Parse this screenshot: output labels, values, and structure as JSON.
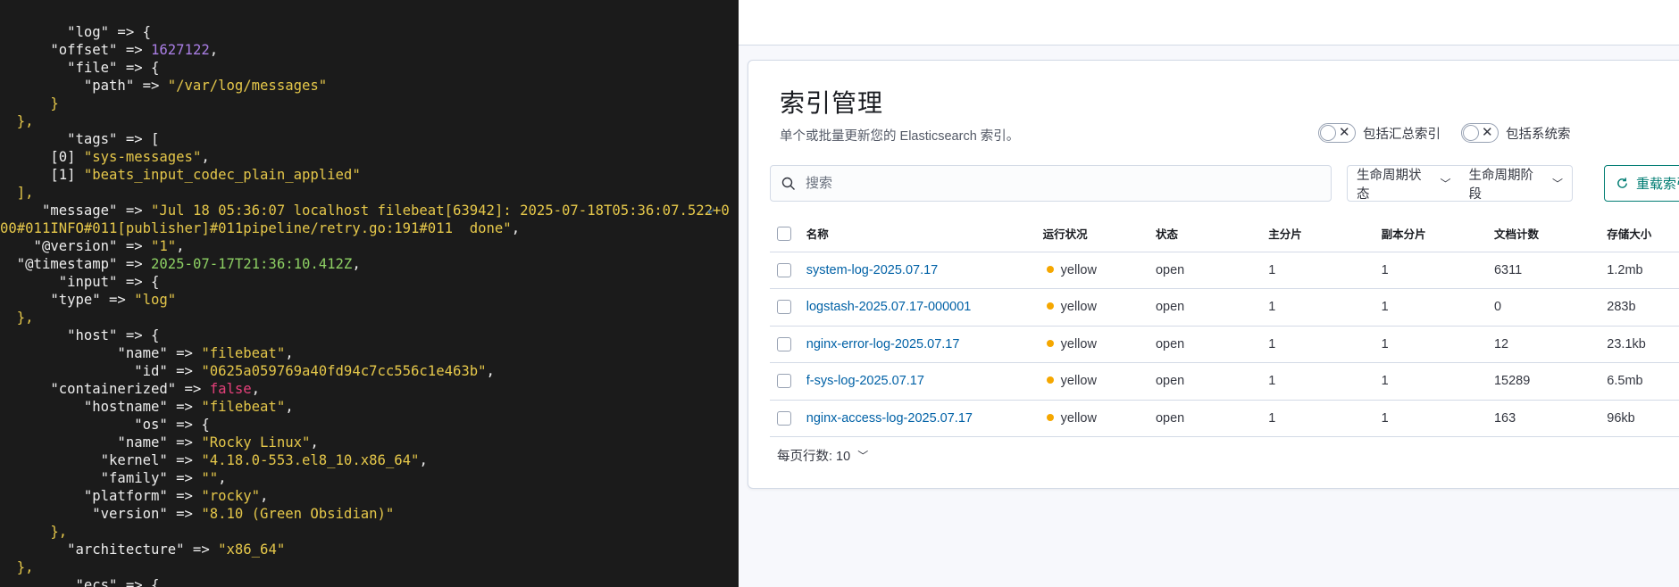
{
  "terminal": {
    "lines": [
      [
        {
          "t": "        \"log\" => {",
          "c": "k"
        }
      ],
      [
        {
          "t": "      \"offset\" => ",
          "c": "k"
        },
        {
          "t": "1627122",
          "c": "n"
        },
        {
          "t": ",",
          "c": "k"
        }
      ],
      [
        {
          "t": "        \"file\" => {",
          "c": "k"
        }
      ],
      [
        {
          "t": "          \"path\" => ",
          "c": "k"
        },
        {
          "t": "\"/var/log/messages\"",
          "c": "s"
        }
      ],
      [
        {
          "t": "      }",
          "c": "s"
        }
      ],
      [
        {
          "t": "  },",
          "c": "s"
        }
      ],
      [
        {
          "t": "        \"tags\" => [",
          "c": "k"
        }
      ],
      [
        {
          "t": "      [0] ",
          "c": "k"
        },
        {
          "t": "\"sys-messages\"",
          "c": "s"
        },
        {
          "t": ",",
          "c": "k"
        }
      ],
      [
        {
          "t": "      [1] ",
          "c": "k"
        },
        {
          "t": "\"beats_input_codec_plain_applied\"",
          "c": "s"
        }
      ],
      [
        {
          "t": "  ],",
          "c": "s"
        }
      ],
      [
        {
          "t": "     \"message\" => ",
          "c": "k"
        },
        {
          "t": "\"Jul 18 05:36:07 localhost filebeat[63942]: 2025-07-18T05:36:07.522+0",
          "c": "s"
        }
      ],
      [
        {
          "t": "00#011INFO#011[publisher]#011pipeline/retry.go:191#011  done\"",
          "c": "s"
        },
        {
          "t": ",",
          "c": "k"
        }
      ],
      [
        {
          "t": "    \"@version\" => ",
          "c": "k"
        },
        {
          "t": "\"1\"",
          "c": "s"
        },
        {
          "t": ",",
          "c": "k"
        }
      ],
      [
        {
          "t": "  \"@timestamp\" => ",
          "c": "k"
        },
        {
          "t": "2025-07-17T21:36:10.412Z",
          "c": "ts"
        },
        {
          "t": ",",
          "c": "k"
        }
      ],
      [
        {
          "t": "       \"input\" => {",
          "c": "k"
        }
      ],
      [
        {
          "t": "      \"type\" => ",
          "c": "k"
        },
        {
          "t": "\"log\"",
          "c": "s"
        }
      ],
      [
        {
          "t": "  },",
          "c": "s"
        }
      ],
      [
        {
          "t": "        \"host\" => {",
          "c": "k"
        }
      ],
      [
        {
          "t": "              \"name\" => ",
          "c": "k"
        },
        {
          "t": "\"filebeat\"",
          "c": "s"
        },
        {
          "t": ",",
          "c": "k"
        }
      ],
      [
        {
          "t": "                \"id\" => ",
          "c": "k"
        },
        {
          "t": "\"0625a059769a40fd94c7cc556c1e463b\"",
          "c": "s"
        },
        {
          "t": ",",
          "c": "k"
        }
      ],
      [
        {
          "t": "      \"containerized\" => ",
          "c": "k"
        },
        {
          "t": "false",
          "c": "f"
        },
        {
          "t": ",",
          "c": "k"
        }
      ],
      [
        {
          "t": "          \"hostname\" => ",
          "c": "k"
        },
        {
          "t": "\"filebeat\"",
          "c": "s"
        },
        {
          "t": ",",
          "c": "k"
        }
      ],
      [
        {
          "t": "                \"os\" => {",
          "c": "k"
        }
      ],
      [
        {
          "t": "              \"name\" => ",
          "c": "k"
        },
        {
          "t": "\"Rocky Linux\"",
          "c": "s"
        },
        {
          "t": ",",
          "c": "k"
        }
      ],
      [
        {
          "t": "            \"kernel\" => ",
          "c": "k"
        },
        {
          "t": "\"4.18.0-553.el8_10.x86_64\"",
          "c": "s"
        },
        {
          "t": ",",
          "c": "k"
        }
      ],
      [
        {
          "t": "            \"family\" => ",
          "c": "k"
        },
        {
          "t": "\"\"",
          "c": "s"
        },
        {
          "t": ",",
          "c": "k"
        }
      ],
      [
        {
          "t": "          \"platform\" => ",
          "c": "k"
        },
        {
          "t": "\"rocky\"",
          "c": "s"
        },
        {
          "t": ",",
          "c": "k"
        }
      ],
      [
        {
          "t": "           \"version\" => ",
          "c": "k"
        },
        {
          "t": "\"8.10 (Green Obsidian)\"",
          "c": "s"
        }
      ],
      [
        {
          "t": "      },",
          "c": "s"
        }
      ],
      [
        {
          "t": "        \"architecture\" => ",
          "c": "k"
        },
        {
          "t": "\"x86_64\"",
          "c": "s"
        }
      ],
      [
        {
          "t": "  },",
          "c": "s"
        }
      ],
      [
        {
          "t": "         \"ecs\" => {",
          "c": "k"
        }
      ]
    ]
  },
  "kibana": {
    "title": "索引管理",
    "description": "单个或批量更新您的 Elasticsearch 索引。",
    "switch_rollup": "包括汇总索引",
    "switch_system": "包括系统索",
    "search_placeholder": "搜索",
    "filter_lifecycle_status": "生命周期状态",
    "filter_lifecycle_phase": "生命周期阶段",
    "reload_button": "重载索引",
    "columns": {
      "name": "名称",
      "health": "运行状况",
      "status": "状态",
      "primary": "主分片",
      "replica": "副本分片",
      "docs": "文档计数",
      "size": "存储大小"
    },
    "rows": [
      {
        "name": "system-log-2025.07.17",
        "health": "yellow",
        "status": "open",
        "primary": "1",
        "replica": "1",
        "docs": "6311",
        "size": "1.2mb"
      },
      {
        "name": "logstash-2025.07.17-000001",
        "health": "yellow",
        "status": "open",
        "primary": "1",
        "replica": "1",
        "docs": "0",
        "size": "283b"
      },
      {
        "name": "nginx-error-log-2025.07.17",
        "health": "yellow",
        "status": "open",
        "primary": "1",
        "replica": "1",
        "docs": "12",
        "size": "23.1kb"
      },
      {
        "name": "f-sys-log-2025.07.17",
        "health": "yellow",
        "status": "open",
        "primary": "1",
        "replica": "1",
        "docs": "15289",
        "size": "6.5mb"
      },
      {
        "name": "nginx-access-log-2025.07.17",
        "health": "yellow",
        "status": "open",
        "primary": "1",
        "replica": "1",
        "docs": "163",
        "size": "96kb"
      }
    ],
    "rows_per_page": "每页行数: 10",
    "colors": {
      "health_yellow": "#f5a700",
      "link": "#0061a6",
      "accent": "#017d73"
    }
  }
}
